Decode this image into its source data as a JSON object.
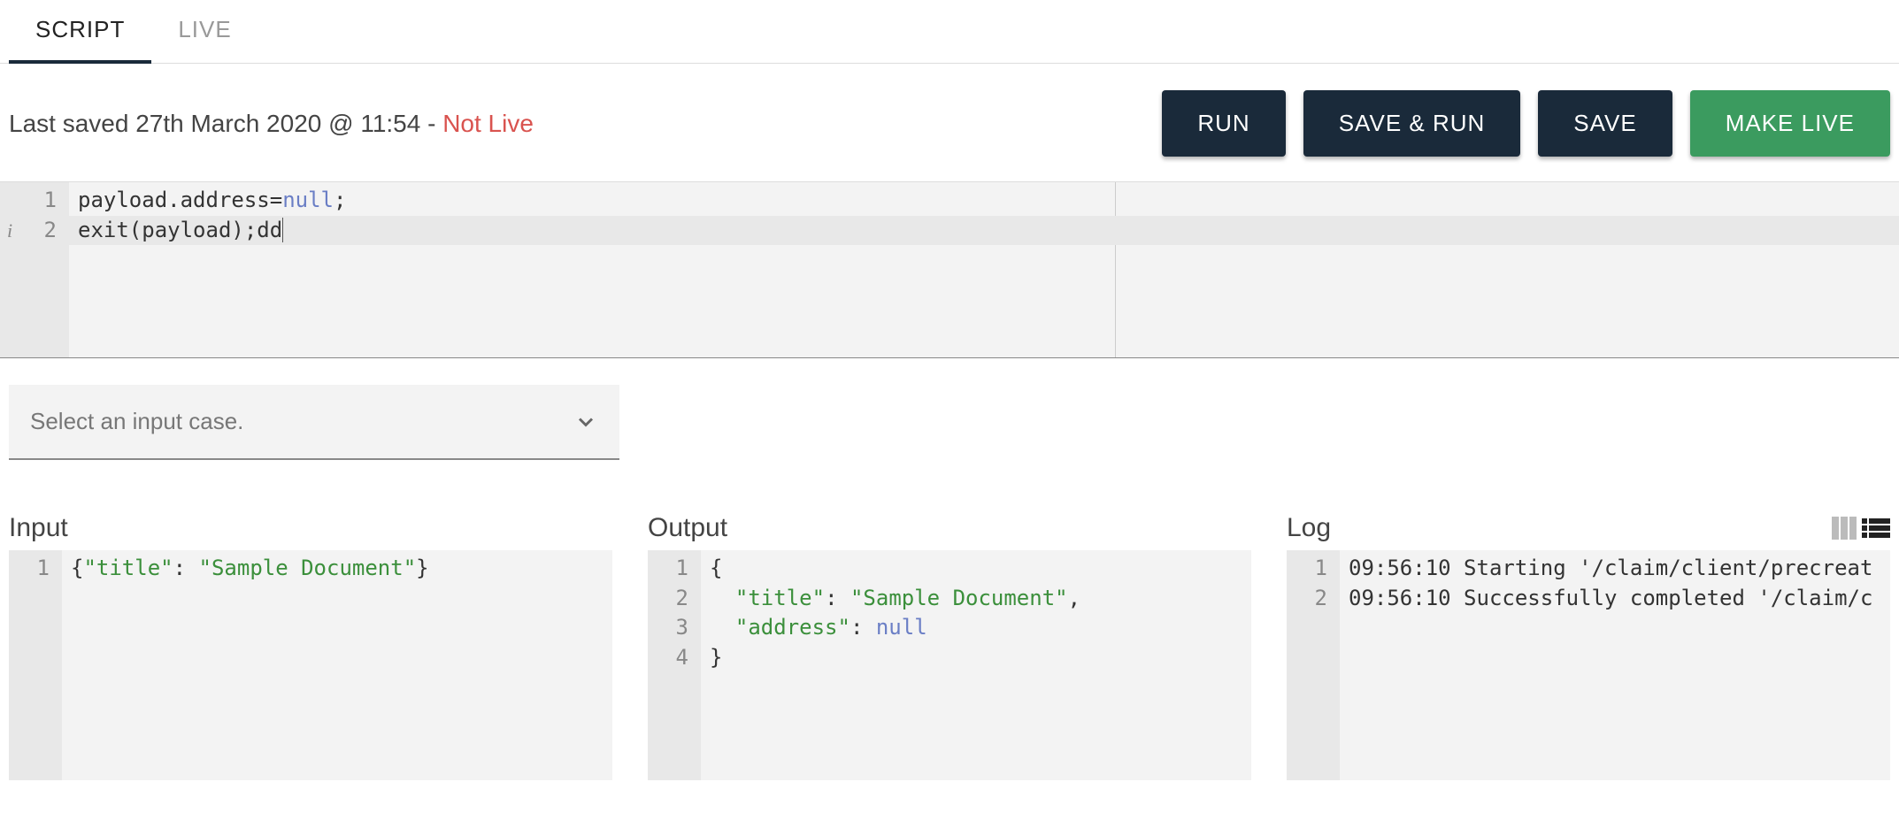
{
  "tabs": {
    "script": "SCRIPT",
    "live": "LIVE",
    "active": "script"
  },
  "status": {
    "prefix": "Last saved 27th March 2020 @ 11:54 - ",
    "not_live": "Not Live"
  },
  "buttons": {
    "run": "RUN",
    "save_run": "SAVE & RUN",
    "save": "SAVE",
    "make_live": "MAKE LIVE"
  },
  "editor": {
    "lines": [
      {
        "n": "1",
        "tokens": [
          {
            "t": "payload.address",
            "c": "plain"
          },
          {
            "t": "=",
            "c": "plain"
          },
          {
            "t": "null",
            "c": "null"
          },
          {
            "t": ";",
            "c": "plain"
          }
        ]
      },
      {
        "n": "2",
        "info": true,
        "tokens": [
          {
            "t": "exit(payload);dd",
            "c": "plain"
          }
        ]
      }
    ]
  },
  "select": {
    "placeholder": "Select an input case."
  },
  "panels": {
    "input": {
      "title": "Input",
      "lines": [
        {
          "n": "1",
          "tokens": [
            {
              "t": "{",
              "c": "punc"
            },
            {
              "t": "\"title\"",
              "c": "key"
            },
            {
              "t": ": ",
              "c": "punc"
            },
            {
              "t": "\"Sample Document\"",
              "c": "str"
            },
            {
              "t": "}",
              "c": "punc"
            }
          ]
        }
      ]
    },
    "output": {
      "title": "Output",
      "lines": [
        {
          "n": "1",
          "tokens": [
            {
              "t": "{",
              "c": "punc"
            }
          ]
        },
        {
          "n": "2",
          "tokens": [
            {
              "t": "  ",
              "c": "plain"
            },
            {
              "t": "\"title\"",
              "c": "key"
            },
            {
              "t": ": ",
              "c": "punc"
            },
            {
              "t": "\"Sample Document\"",
              "c": "str"
            },
            {
              "t": ",",
              "c": "punc"
            }
          ]
        },
        {
          "n": "3",
          "tokens": [
            {
              "t": "  ",
              "c": "plain"
            },
            {
              "t": "\"address\"",
              "c": "key"
            },
            {
              "t": ": ",
              "c": "punc"
            },
            {
              "t": "null",
              "c": "null"
            }
          ]
        },
        {
          "n": "4",
          "tokens": [
            {
              "t": "}",
              "c": "punc"
            }
          ]
        }
      ]
    },
    "log": {
      "title": "Log",
      "lines": [
        {
          "n": "1",
          "tokens": [
            {
              "t": "09:56:10 Starting '/claim/client/precreat",
              "c": "plain"
            }
          ]
        },
        {
          "n": "2",
          "tokens": [
            {
              "t": "09:56:10 Successfully completed '/claim/c",
              "c": "plain"
            }
          ]
        }
      ]
    }
  }
}
